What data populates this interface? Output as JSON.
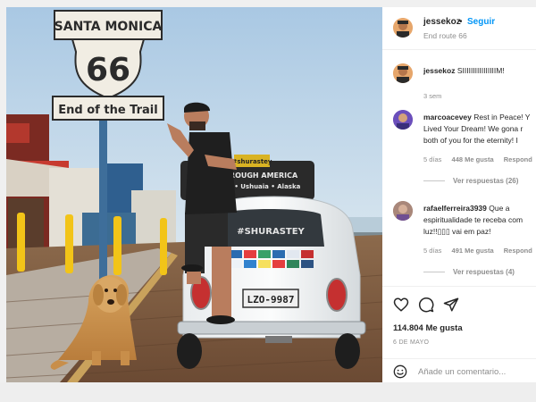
{
  "photo": {
    "sign_top": "SANTA MONICA",
    "sign_number": "66",
    "sign_bottom": "End of the Trail",
    "rack_brand": "#shurastey",
    "rack_line1": "THROUGH AMERICA",
    "rack_line2": "ború • Ushuaia • Alaska",
    "car_window_text": "#SHURASTEY",
    "plate": "LZO-9987"
  },
  "header": {
    "username": "jessekoz",
    "separator": "•",
    "follow_label": "Seguir",
    "location": "End route 66"
  },
  "comments": [
    {
      "user": "jessekoz",
      "lines": [
        "SIIIIIIIIIIIIIIIIM!"
      ],
      "time": "3 sem"
    },
    {
      "user": "marcoacevey",
      "lines": [
        "Rest in Peace! Y",
        "Lived Your Dream! We gona r",
        "both of you for the eternity! I"
      ],
      "time": "5 días",
      "likes": "448 Me gusta",
      "reply": "Respond",
      "view_replies": "Ver respuestas (26)"
    },
    {
      "user": "rafaelferreira3939",
      "lines": [
        "Que a",
        "espiritualidade te receba com",
        "luz!!▯▯▯ vai em paz!"
      ],
      "time": "5 días",
      "likes": "491 Me gusta",
      "reply": "Respond",
      "view_replies": "Ver respuestas (4)"
    }
  ],
  "actions": {
    "icons": [
      "heart-icon",
      "comment-icon",
      "share-icon"
    ],
    "likes": "114.804 Me gusta",
    "date": "6 DE MAYO",
    "add_comment_placeholder": "Añade un comentario..."
  },
  "colors": {
    "accent": "#0095f6",
    "muted": "#8e8e8e",
    "text": "#262626"
  }
}
